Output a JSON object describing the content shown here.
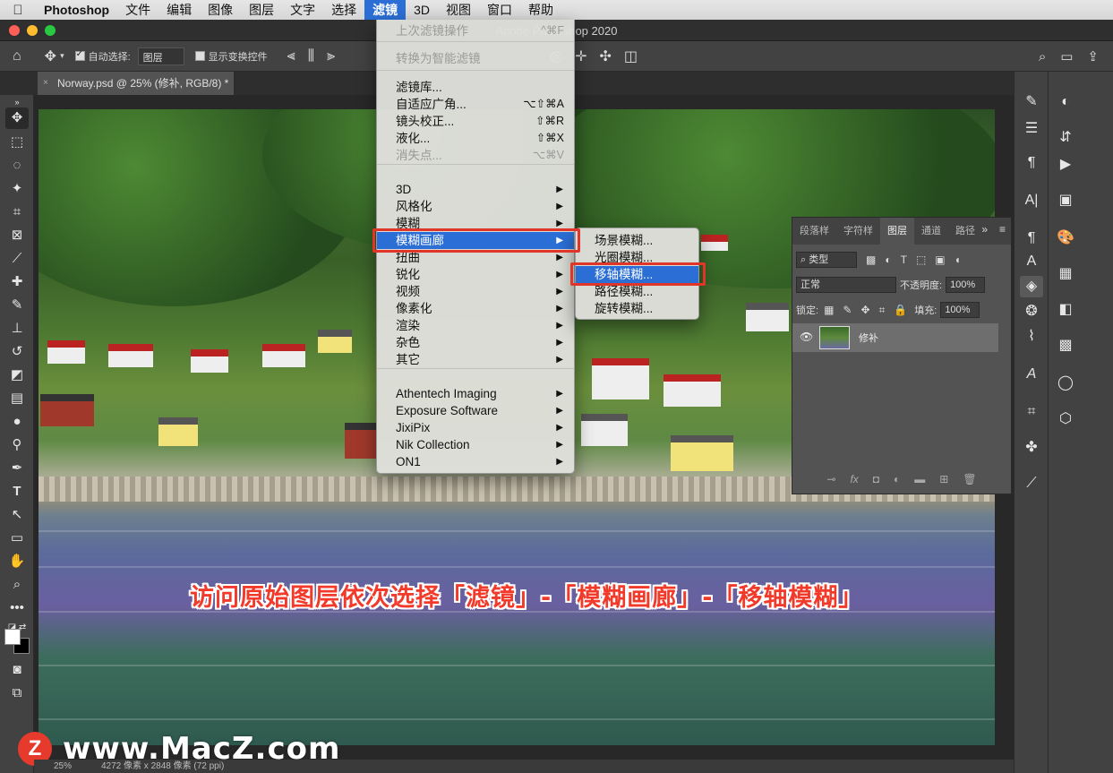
{
  "menubar": {
    "items": [
      {
        "label": "Photoshop",
        "bold": true
      },
      {
        "label": "文件"
      },
      {
        "label": "编辑"
      },
      {
        "label": "图像"
      },
      {
        "label": "图层"
      },
      {
        "label": "文字"
      },
      {
        "label": "选择"
      },
      {
        "label": "滤镜",
        "active": true
      },
      {
        "label": "3D"
      },
      {
        "label": "视图"
      },
      {
        "label": "窗口"
      },
      {
        "label": "帮助"
      }
    ]
  },
  "window": {
    "title": "Adobe Photoshop 2020"
  },
  "options_bar": {
    "auto_select_label": "自动选择:",
    "auto_select_value": "图层",
    "show_transform_label": "显示变换控件"
  },
  "document": {
    "tab_label": "Norway.psd @ 25% (修补, RGB/8) *",
    "zoom": "25%",
    "info": "4272 像素 x 2848 像素 (72 ppi)"
  },
  "filter_menu": {
    "items": [
      {
        "label": "上次滤镜操作",
        "shortcut": "^⌘F",
        "disabled": true
      },
      {
        "label": "转换为智能滤镜",
        "disabled": true
      },
      {
        "label": "滤镜库..."
      },
      {
        "label": "自适应广角...",
        "shortcut": "⌥⇧⌘A"
      },
      {
        "label": "镜头校正...",
        "shortcut": "⇧⌘R"
      },
      {
        "label": "液化...",
        "shortcut": "⇧⌘X"
      },
      {
        "label": "消失点...",
        "shortcut": "⌥⌘V",
        "disabled": true
      },
      {
        "label": "3D",
        "submenu": true
      },
      {
        "label": "风格化",
        "submenu": true
      },
      {
        "label": "模糊",
        "submenu": true
      },
      {
        "label": "模糊画廊",
        "submenu": true,
        "highlighted": true
      },
      {
        "label": "扭曲",
        "submenu": true
      },
      {
        "label": "锐化",
        "submenu": true
      },
      {
        "label": "视频",
        "submenu": true
      },
      {
        "label": "像素化",
        "submenu": true
      },
      {
        "label": "渲染",
        "submenu": true
      },
      {
        "label": "杂色",
        "submenu": true
      },
      {
        "label": "其它",
        "submenu": true
      },
      {
        "label": "Athentech Imaging",
        "submenu": true
      },
      {
        "label": "Exposure Software",
        "submenu": true
      },
      {
        "label": "JixiPix",
        "submenu": true
      },
      {
        "label": "Nik Collection",
        "submenu": true
      },
      {
        "label": "ON1",
        "submenu": true
      }
    ]
  },
  "blur_gallery_submenu": {
    "items": [
      {
        "label": "场景模糊..."
      },
      {
        "label": "光圈模糊..."
      },
      {
        "label": "移轴模糊...",
        "highlighted": true
      },
      {
        "label": "路径模糊..."
      },
      {
        "label": "旋转模糊..."
      }
    ]
  },
  "layers_panel": {
    "tabs": [
      "段落样",
      "字符样",
      "图层",
      "通道",
      "路径"
    ],
    "active_tab": "图层",
    "filter_type": "类型",
    "blend_mode": "正常",
    "opacity_label": "不透明度:",
    "opacity_value": "100%",
    "lock_label": "锁定:",
    "fill_label": "填充:",
    "fill_value": "100%",
    "layer_name": "修补"
  },
  "caption": "访问原始图层依次选择「滤镜」-「模糊画廊」-「移轴模糊」",
  "watermark": {
    "logo_letter": "Z",
    "text": "www.MacZ.com"
  },
  "colors": {
    "menu_highlight": "#2b6fd6",
    "annotation_red": "#e2352a",
    "caption_red": "#f13a2a"
  }
}
